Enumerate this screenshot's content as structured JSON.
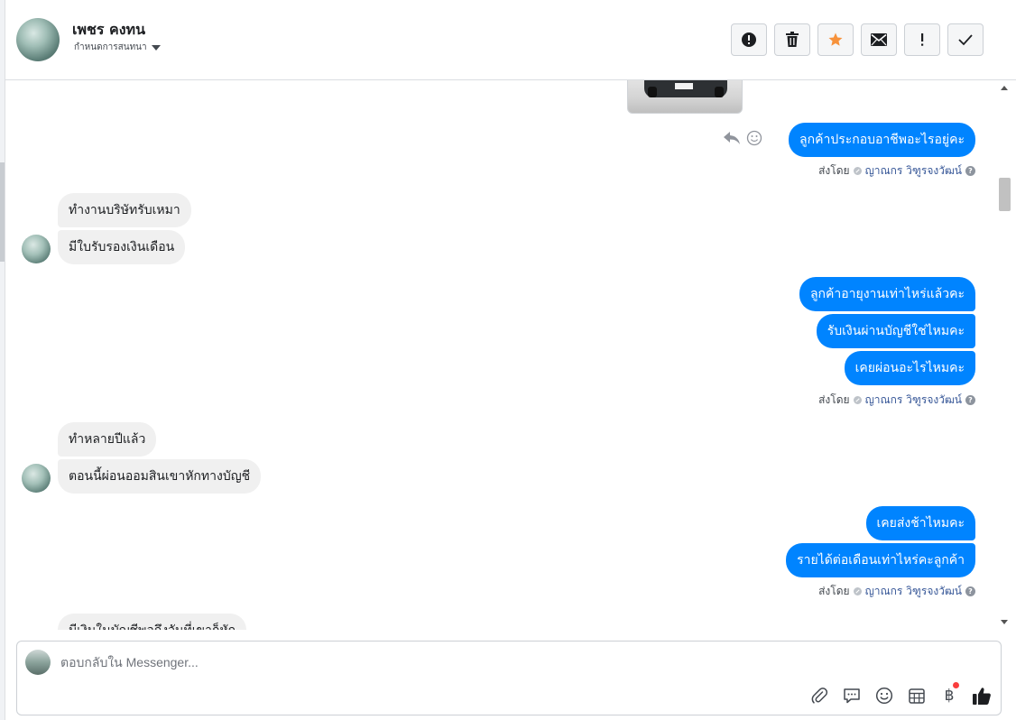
{
  "header": {
    "contact_name": "เพชร คงทน",
    "assign_label": "กำหนดการสนทนา",
    "toolbar": [
      "spam-icon",
      "trash-icon",
      "star-icon",
      "envelope-icon",
      "exclamation-icon",
      "check-icon"
    ],
    "colors": {
      "star": "#f7923b",
      "icon": "#1c1e21"
    }
  },
  "thread": {
    "sent_by_label": "ส่งโดย",
    "agent_name": "ญาณกร วิฑูรจงวัฒน์",
    "out_1": "ลูกค้าประกอบอาชีพอะไรอยู่คะ",
    "in_1a": "ทำงานบริษัทรับเหมา",
    "in_1b": "มีใบรับรองเงินเดือน",
    "out_2a": "ลูกค้าอายุงานเท่าไหร่แล้วคะ",
    "out_2b": "รับเงินผ่านบัญชีใช่ไหมคะ",
    "out_2c": "เคยผ่อนอะไรไหมคะ",
    "in_2a": "ทำหลายปีแล้ว",
    "in_2b": "ตอนนี้ผ่อนออมสินเขาหักทางบัญชี",
    "out_3a": "เคยส่งช้าไหมคะ",
    "out_3b": "รายได้ต่อเดือนเท่าไหร่คะลูกค้า",
    "in_3a_partial": "มีเงินในบัญชีพอถึงวันที่เขาก็หัก",
    "colors": {
      "outgoing": "#0084ff",
      "incoming": "#f0f0f0",
      "agent_link": "#385898"
    }
  },
  "composer": {
    "placeholder": "ตอบกลับใน Messenger...",
    "tools": [
      "paperclip-icon",
      "saved-reply-icon",
      "emoji-icon",
      "appointment-icon",
      "baht-icon",
      "thumbs-up-icon"
    ],
    "baht_symbol": "฿"
  }
}
